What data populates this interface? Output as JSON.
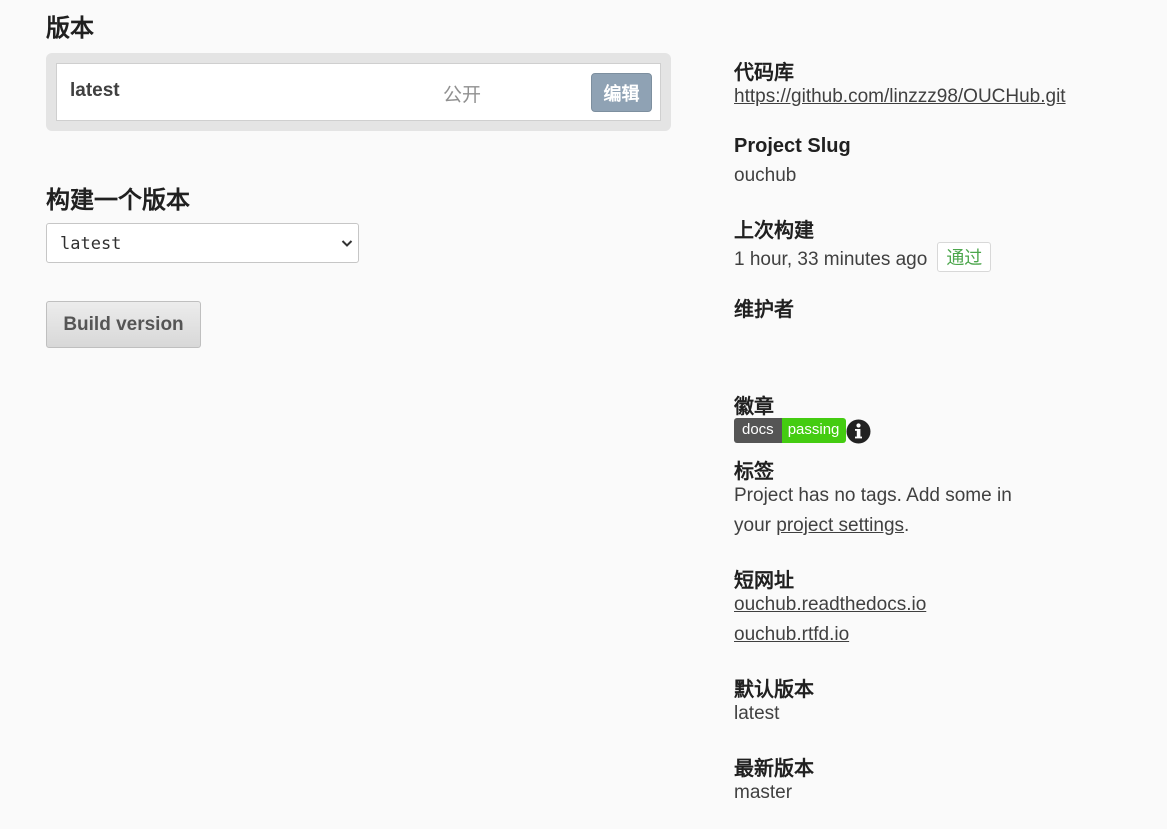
{
  "versions": {
    "heading": "版本",
    "items": [
      {
        "name": "latest",
        "privacy": "公开",
        "edit_label": "编辑"
      }
    ]
  },
  "build": {
    "heading": "构建一个版本",
    "selected_version": "latest",
    "button_label": "Build version"
  },
  "sidebar": {
    "repo": {
      "label": "代码库",
      "url": "https://github.com/linzzz98/OUCHub.git"
    },
    "slug": {
      "label": "Project Slug",
      "value": "ouchub"
    },
    "last_build": {
      "label": "上次构建",
      "time": "1 hour, 33 minutes ago",
      "status": "通过",
      "status_color": "#4ca64c"
    },
    "maintainers": {
      "label": "维护者"
    },
    "badge": {
      "label": "徽章",
      "left_text": "docs",
      "right_text": "passing",
      "left_color": "#555555",
      "right_color": "#44cc11",
      "icon": "info-icon"
    },
    "tags": {
      "label": "标签",
      "text_line1": "Project has no tags. Add some in",
      "text_line2_prefix": "your ",
      "settings_link": "project settings",
      "text_line2_suffix": "."
    },
    "short_urls": {
      "label": "短网址",
      "urls": [
        "ouchub.readthedocs.io",
        "ouchub.rtfd.io"
      ]
    },
    "default_version": {
      "label": "默认版本",
      "value": "latest"
    },
    "latest_version": {
      "label": "最新版本",
      "value": "master"
    }
  }
}
